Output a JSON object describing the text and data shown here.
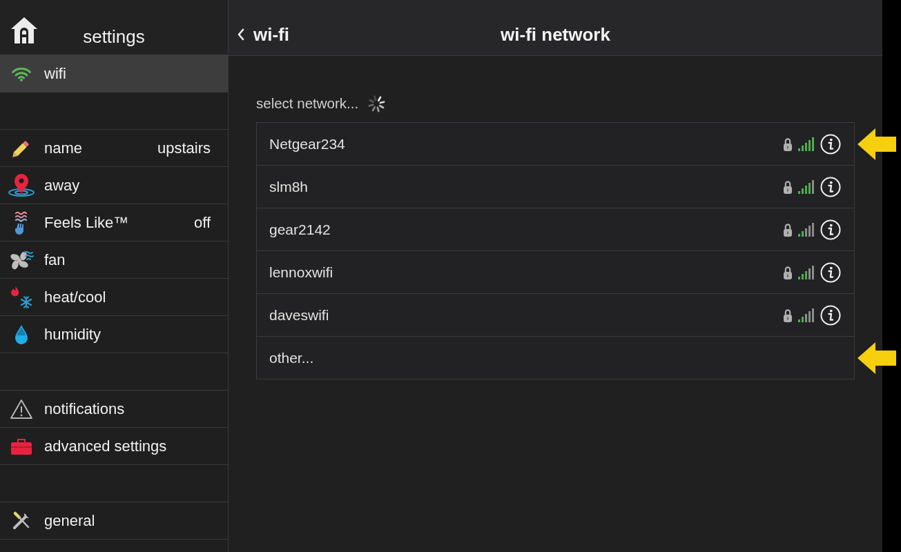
{
  "sidebar": {
    "title": "settings",
    "groups": [
      {
        "items": [
          {
            "kind": "network",
            "label": "wifi",
            "selected": true
          }
        ]
      },
      {
        "items": [
          {
            "kind": "name",
            "label": "name",
            "value": "upstairs",
            "selected": false
          },
          {
            "kind": "away",
            "label": "away",
            "selected": false
          },
          {
            "kind": "feels-like",
            "label": "Feels Like™",
            "value": "off",
            "selected": false
          },
          {
            "kind": "fan",
            "label": "fan",
            "selected": false
          },
          {
            "kind": "mode",
            "label": "heat/cool",
            "selected": false
          },
          {
            "kind": "humidity",
            "label": "humidity",
            "selected": false
          }
        ]
      },
      {
        "items": [
          {
            "kind": "alerts",
            "label": "notifications",
            "selected": false
          },
          {
            "kind": "advanced",
            "label": "advanced settings",
            "selected": false
          }
        ]
      },
      {
        "items": [
          {
            "kind": "general",
            "label": "general",
            "selected": false
          }
        ]
      }
    ]
  },
  "header": {
    "back": "wi-fi",
    "title": "wi-fi network"
  },
  "network_list": {
    "prompt": "select network...",
    "loading": true,
    "networks": [
      {
        "kind": "excellent",
        "name": "Netgear234",
        "locked": true,
        "callout_arrow": true
      },
      {
        "kind": "good",
        "name": "slm8h",
        "locked": true,
        "callout_arrow": false
      },
      {
        "kind": "weak",
        "name": "gear2142",
        "locked": true,
        "callout_arrow": false
      },
      {
        "kind": "fair",
        "name": "lennoxwifi",
        "locked": true,
        "callout_arrow": false
      },
      {
        "kind": "weak",
        "name": "daveswifi",
        "locked": true,
        "callout_arrow": false
      },
      {
        "kind": "manual",
        "name": "other...",
        "callout_arrow": true
      }
    ]
  }
}
